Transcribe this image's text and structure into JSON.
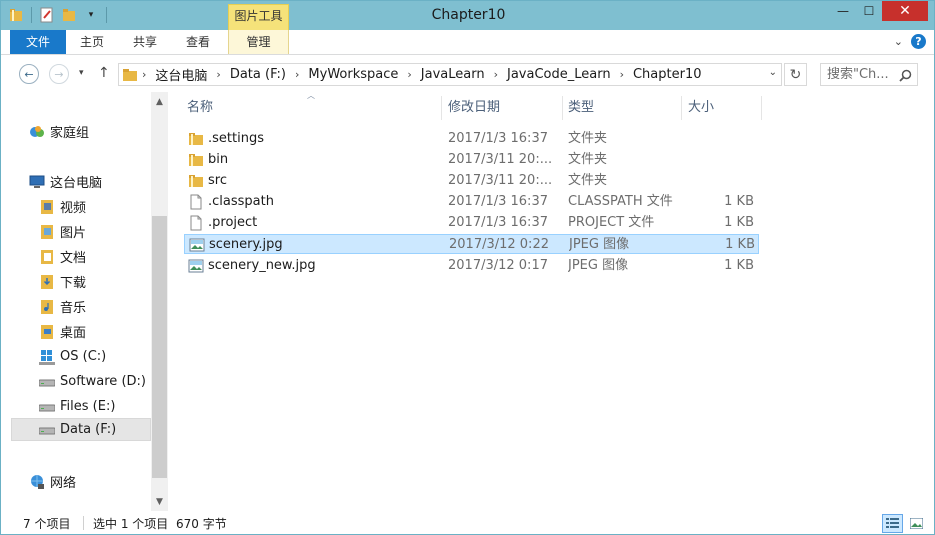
{
  "window": {
    "title": "Chapter10",
    "context_tab_header": "图片工具"
  },
  "ribbon": {
    "tabs": [
      "文件",
      "主页",
      "共享",
      "查看",
      "管理"
    ]
  },
  "address": {
    "crumbs": [
      "这台电脑",
      "Data (F:)",
      "MyWorkspace",
      "JavaLearn",
      "JavaCode_Learn",
      "Chapter10"
    ]
  },
  "search": {
    "placeholder": "搜索\"Ch..."
  },
  "nav": {
    "homegroup": "家庭组",
    "this_pc": "这台电脑",
    "items": [
      "视频",
      "图片",
      "文档",
      "下载",
      "音乐",
      "桌面",
      "OS (C:)",
      "Software (D:)",
      "Files (E:)",
      "Data (F:)"
    ],
    "network": "网络"
  },
  "columns": {
    "name": "名称",
    "date": "修改日期",
    "type": "类型",
    "size": "大小"
  },
  "files": [
    {
      "name": ".settings",
      "date": "2017/1/3 16:37",
      "type": "文件夹",
      "size": "",
      "icon": "folder-icon"
    },
    {
      "name": "bin",
      "date": "2017/3/11 20:...",
      "type": "文件夹",
      "size": "",
      "icon": "folder-icon"
    },
    {
      "name": "src",
      "date": "2017/3/11 20:...",
      "type": "文件夹",
      "size": "",
      "icon": "folder-icon"
    },
    {
      "name": ".classpath",
      "date": "2017/1/3 16:37",
      "type": "CLASSPATH 文件",
      "size": "1 KB",
      "icon": "file-icon"
    },
    {
      "name": ".project",
      "date": "2017/1/3 16:37",
      "type": "PROJECT 文件",
      "size": "1 KB",
      "icon": "file-icon"
    },
    {
      "name": "scenery.jpg",
      "date": "2017/3/12 0:22",
      "type": "JPEG 图像",
      "size": "1 KB",
      "icon": "image-icon"
    },
    {
      "name": "scenery_new.jpg",
      "date": "2017/3/12 0:17",
      "type": "JPEG 图像",
      "size": "1 KB",
      "icon": "image-icon"
    }
  ],
  "status": {
    "count": "7 个项目",
    "selected": "选中 1 个项目",
    "size": "670 字节"
  },
  "colors": {
    "titlebar": "#7fbfd0",
    "file_tab": "#1979ca",
    "selection": "#cce8ff",
    "close": "#c7302c"
  }
}
